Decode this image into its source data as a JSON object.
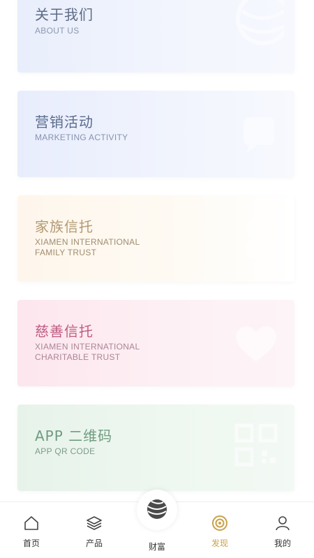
{
  "cards": [
    {
      "title": "关于我们",
      "subtitle": "ABOUT US",
      "icon": "globe-watermark-icon"
    },
    {
      "title": "营销活动",
      "subtitle": "MARKETING ACTIVITY",
      "icon": "speech-watermark-icon"
    },
    {
      "title": "家族信托",
      "subtitle": "XIAMEN INTERNATIONAL\nFAMILY TRUST",
      "icon": "family-watermark-icon"
    },
    {
      "title": "慈善信托",
      "subtitle": "XIAMEN INTERNATIONAL\nCHARITABLE TRUST",
      "icon": "heart-hands-watermark-icon"
    },
    {
      "title": "APP 二维码",
      "subtitle": "APP QR CODE",
      "icon": "qr-code-watermark-icon"
    }
  ],
  "tabbar": {
    "items": [
      {
        "label": "首页",
        "icon": "home-icon",
        "active": false
      },
      {
        "label": "产品",
        "icon": "layers-icon",
        "active": false
      },
      {
        "label": "财富",
        "icon": "globe-icon",
        "active": false
      },
      {
        "label": "发现",
        "icon": "target-icon",
        "active": true
      },
      {
        "label": "我的",
        "icon": "user-icon",
        "active": false
      }
    ]
  },
  "colors": {
    "active_tab": "#c9a24a",
    "inactive_tab": "#333333"
  }
}
